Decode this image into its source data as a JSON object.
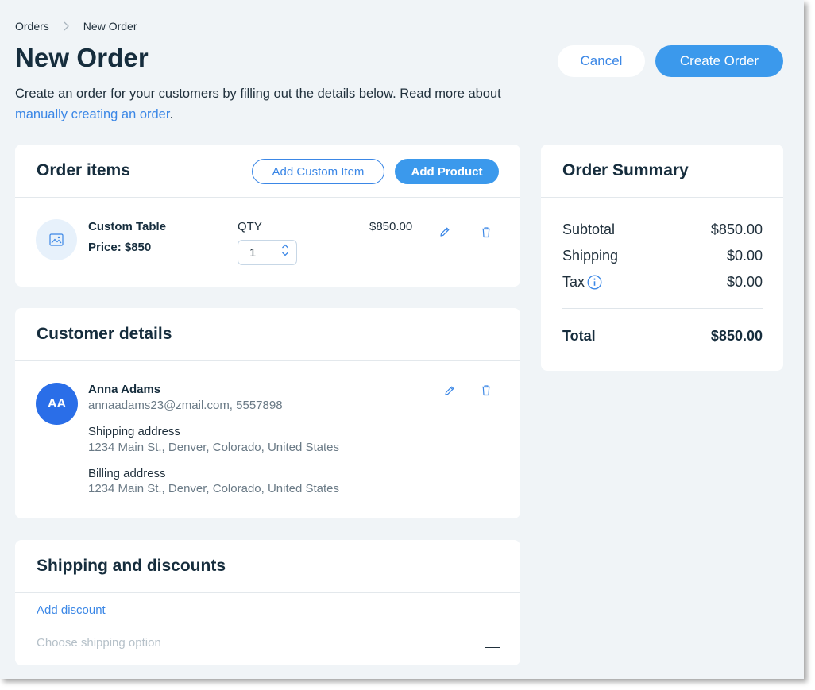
{
  "breadcrumb": {
    "parent": "Orders",
    "current": "New Order"
  },
  "page": {
    "title": "New Order",
    "description_prefix": "Create an order for your customers by filling out the details below. Read more about ",
    "description_link": "manually creating an order",
    "description_suffix": "."
  },
  "header_actions": {
    "cancel_label": "Cancel",
    "create_label": "Create Order"
  },
  "order_items": {
    "title": "Order items",
    "add_custom_label": "Add Custom Item",
    "add_product_label": "Add Product",
    "items": [
      {
        "name": "Custom Table",
        "price_label": "Price: $850",
        "qty_label": "QTY",
        "qty": "1",
        "total": "$850.00"
      }
    ]
  },
  "customer": {
    "title": "Customer details",
    "initials": "AA",
    "name": "Anna Adams",
    "contact": "annaadams23@zmail.com, 5557898",
    "shipping_label": "Shipping address",
    "shipping_address": "1234 Main St., Denver, Colorado, United States",
    "billing_label": "Billing address",
    "billing_address": "1234 Main St., Denver, Colorado, United States"
  },
  "shipping_discounts": {
    "title": "Shipping and discounts",
    "add_discount_label": "Add discount",
    "shipping_placeholder": "Choose shipping option"
  },
  "summary": {
    "title": "Order Summary",
    "rows": [
      {
        "label": "Subtotal",
        "value": "$850.00"
      },
      {
        "label": "Shipping",
        "value": "$0.00"
      },
      {
        "label": "Tax",
        "value": "$0.00"
      }
    ],
    "total_label": "Total",
    "total_value": "$850.00"
  },
  "icons": {
    "breadcrumb_separator": "chevron-right-icon",
    "item_thumbnail": "image-placeholder-icon",
    "edit": "pencil-icon",
    "delete": "trash-icon",
    "qty_up": "chevron-up-icon",
    "qty_down": "chevron-down-icon",
    "tax_info": "info-icon"
  },
  "colors": {
    "accent": "#3b99ec",
    "link": "#3b87e6",
    "avatar": "#2a6ee8",
    "page_background": "#f0f4f7",
    "text_primary": "#162d3d"
  }
}
